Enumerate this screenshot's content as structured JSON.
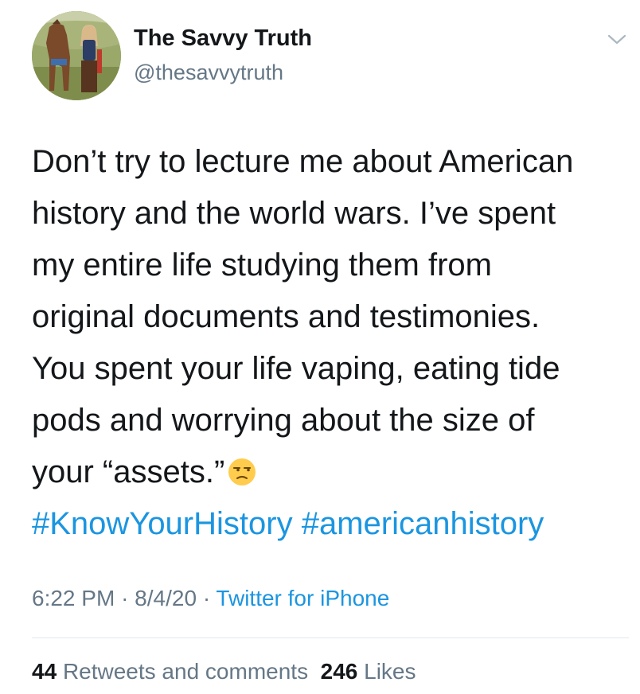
{
  "author": {
    "display_name": "The Savvy Truth",
    "handle": "@thesavvytruth"
  },
  "tweet": {
    "lines": [
      "Don’t try to lecture me about American",
      "history and the world wars. I’ve spent",
      "my entire life studying them from",
      "original documents and testimonies.",
      "You spent your life vaping, eating tide",
      "pods and worrying about the size of",
      "your “assets.”"
    ],
    "emoji": "unamused-face-emoji",
    "hashtags": [
      "#KnowYourHistory",
      "#americanhistory"
    ]
  },
  "meta": {
    "time": "6:22 PM",
    "separator": "·",
    "date": "8/4/20",
    "source": "Twitter for iPhone"
  },
  "stats": {
    "retweets_count": "44",
    "retweets_label": "Retweets and comments",
    "likes_count": "246",
    "likes_label": "Likes"
  },
  "colors": {
    "link": "#1b95e0",
    "secondary_text": "#657786",
    "primary_text": "#14171a",
    "divider": "#e1e8ed"
  },
  "icons": {
    "menu": "chevron-down-icon"
  }
}
